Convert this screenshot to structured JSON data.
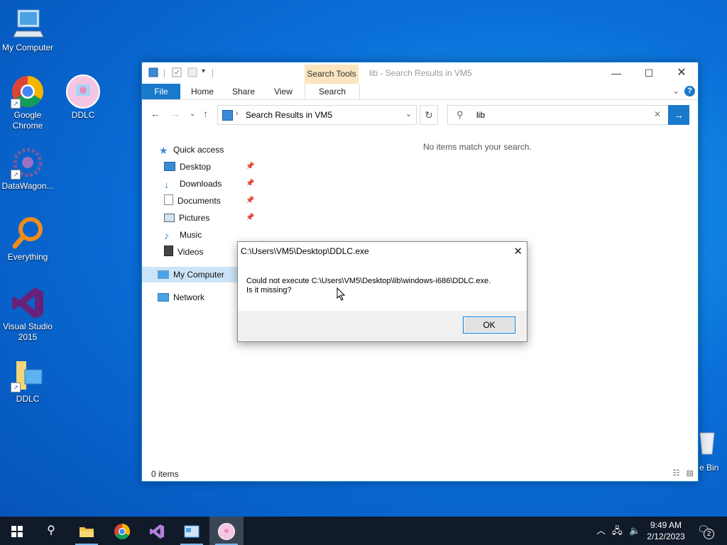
{
  "desktop": {
    "icons": [
      {
        "label": "My Computer"
      },
      {
        "label": "Google\nChrome"
      },
      {
        "label": "DDLC"
      },
      {
        "label": "DataWagon..."
      },
      {
        "label": "Everything"
      },
      {
        "label": "Visual Studio\n2015"
      },
      {
        "label": "DDLC"
      }
    ],
    "recycle_bin_label": "e Bin"
  },
  "explorer": {
    "title": "lib - Search Results in VM5",
    "contextual_tab": "Search Tools",
    "tabs": [
      "File",
      "Home",
      "Share",
      "View",
      "Search"
    ],
    "address": "Search Results in VM5",
    "search_value": "lib",
    "nav": {
      "quick_access": "Quick access",
      "items": [
        {
          "label": "Desktop",
          "pinned": true
        },
        {
          "label": "Downloads",
          "pinned": true
        },
        {
          "label": "Documents",
          "pinned": true
        },
        {
          "label": "Pictures",
          "pinned": true
        },
        {
          "label": "Music",
          "pinned": false
        },
        {
          "label": "Videos",
          "pinned": false
        }
      ],
      "my_computer": "My Computer",
      "network": "Network"
    },
    "empty_message": "No items match your search.",
    "status": "0 items"
  },
  "dialog": {
    "title": "C:\\Users\\VM5\\Desktop\\DDLC.exe",
    "line1": "Could not execute C:\\Users\\VM5\\Desktop\\lib\\windows-i686\\DDLC.exe.",
    "line2": "Is it missing?",
    "ok": "OK"
  },
  "taskbar": {
    "time": "9:49 AM",
    "date": "2/12/2023",
    "notification_count": "2"
  },
  "colors": {
    "accent": "#1979ca",
    "taskbar": "#101a28",
    "search_tools": "#fbe5bf"
  }
}
